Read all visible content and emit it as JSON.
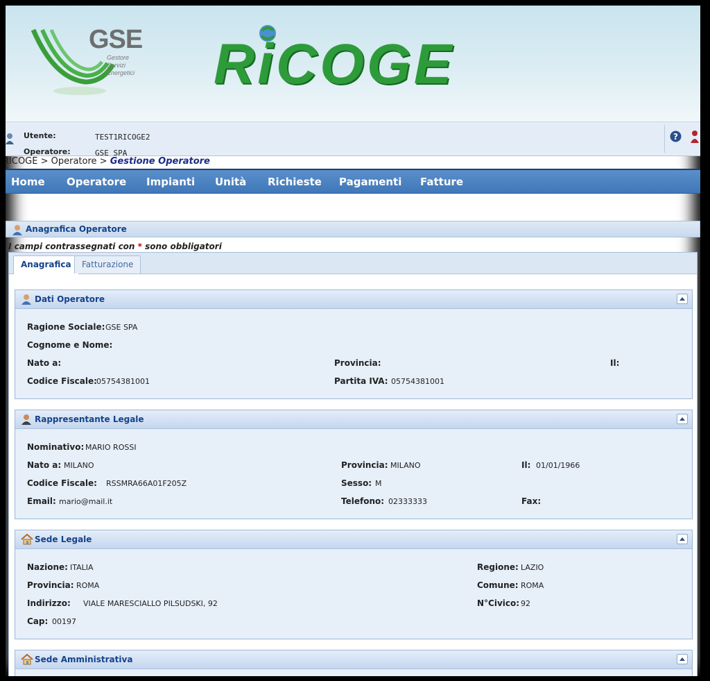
{
  "header": {
    "gse_logo_text": "GSE",
    "gse_logo_sub": "Gestore Servizi Energetici",
    "app_title": "RiCOGE"
  },
  "userbar": {
    "utente_label": "Utente:",
    "utente_value": "TEST1RICOGE2",
    "operatore_label": "Operatore:",
    "operatore_value": "GSE SPA"
  },
  "breadcrumb": {
    "root": "RICOGE",
    "sep1": " > ",
    "level1": "Operatore",
    "sep2": " > ",
    "current": "Gestione Operatore"
  },
  "nav": {
    "items": [
      "Home",
      "Operatore",
      "Impianti",
      "Unità",
      "Richieste",
      "Pagamenti",
      "Fatture"
    ]
  },
  "panel": {
    "title": "Anagrafica Operatore",
    "required_note_pre": "I campi contrassegnati con ",
    "required_star": "*",
    "required_note_post": " sono obbligatori",
    "tabs": [
      "Anagrafica",
      "Fatturazione"
    ]
  },
  "dati_operatore": {
    "title": "Dati Operatore",
    "ragione_sociale_label": "Ragione Sociale:",
    "ragione_sociale_value": "GSE SPA",
    "cognome_nome_label": "Cognome e Nome:",
    "nato_a_label": "Nato a:",
    "provincia_label": "Provincia:",
    "il_label": "Il:",
    "codice_fiscale_label": "Codice Fiscale:",
    "codice_fiscale_value": "05754381001",
    "partita_iva_label": "Partita IVA:",
    "partita_iva_value": "05754381001"
  },
  "rappresentante": {
    "title": "Rappresentante Legale",
    "nominativo_label": "Nominativo:",
    "nominativo_value": "MARIO ROSSI",
    "nato_a_label": "Nato a:",
    "nato_a_value": "MILANO",
    "provincia_label": "Provincia:",
    "provincia_value": "MILANO",
    "il_label": "Il:",
    "il_value": "01/01/1966",
    "codice_fiscale_label": "Codice Fiscale:",
    "codice_fiscale_value": "RSSMRA66A01F205Z",
    "sesso_label": "Sesso:",
    "sesso_value": "M",
    "email_label": "Email:",
    "email_value": "mario@mail.it",
    "telefono_label": "Telefono:",
    "telefono_value": "02333333",
    "fax_label": "Fax:"
  },
  "sede_legale": {
    "title": "Sede Legale",
    "nazione_label": "Nazione:",
    "nazione_value": "ITALIA",
    "regione_label": "Regione:",
    "regione_value": "LAZIO",
    "provincia_label": "Provincia:",
    "provincia_value": "ROMA",
    "comune_label": "Comune:",
    "comune_value": "ROMA",
    "indirizzo_label": "Indirizzo:",
    "indirizzo_value": "VIALE MARESCIALLO PILSUDSKI, 92",
    "civico_label": "N°Civico:",
    "civico_value": "92",
    "cap_label": "Cap:",
    "cap_value": "00197"
  },
  "sede_amministrativa": {
    "title": "Sede Amministrativa"
  },
  "colors": {
    "nav_bg": "#4a82c2",
    "section_title": "#15428b",
    "brand_green": "#2e9b3a"
  }
}
